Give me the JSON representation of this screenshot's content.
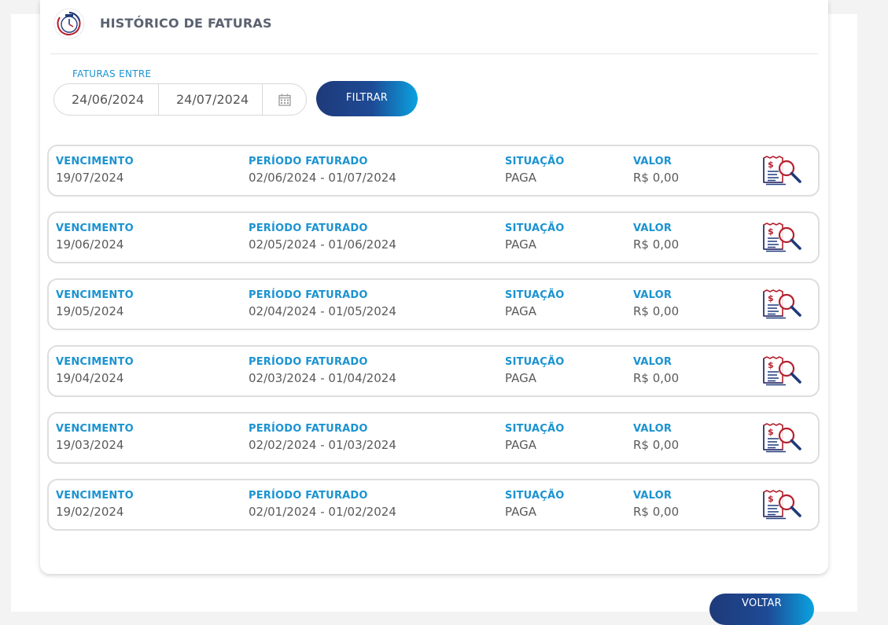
{
  "header": {
    "title": "HISTÓRICO DE FATURAS",
    "icon": "clock-calendar-icon"
  },
  "filter": {
    "label": "FATURAS ENTRE",
    "start_date": "24/06/2024",
    "end_date": "24/07/2024",
    "calendar_icon": "calendar-icon",
    "button_label": "FILTRAR"
  },
  "labels": {
    "due": "VENCIMENTO",
    "period": "PERÍODO FATURADO",
    "status": "SITUAÇÃO",
    "value": "VALOR"
  },
  "invoices": [
    {
      "due": "19/07/2024",
      "period": "02/06/2024 - 01/07/2024",
      "status": "PAGA",
      "value": "R$ 0,00"
    },
    {
      "due": "19/06/2024",
      "period": "02/05/2024 - 01/06/2024",
      "status": "PAGA",
      "value": "R$ 0,00"
    },
    {
      "due": "19/05/2024",
      "period": "02/04/2024 - 01/05/2024",
      "status": "PAGA",
      "value": "R$ 0,00"
    },
    {
      "due": "19/04/2024",
      "period": "02/03/2024 - 01/04/2024",
      "status": "PAGA",
      "value": "R$ 0,00"
    },
    {
      "due": "19/03/2024",
      "period": "02/02/2024 - 01/03/2024",
      "status": "PAGA",
      "value": "R$ 0,00"
    },
    {
      "due": "19/02/2024",
      "period": "02/01/2024 - 01/02/2024",
      "status": "PAGA",
      "value": "R$ 0,00"
    }
  ],
  "invoice_icon": "invoice-search-icon",
  "back_button_label": "VOLTAR",
  "colors": {
    "accent_blue": "#1b93d1",
    "button_dark": "#1e3a7a",
    "button_light": "#0aa2e0",
    "icon_red": "#b5202e",
    "icon_navy": "#1f3a7a"
  }
}
